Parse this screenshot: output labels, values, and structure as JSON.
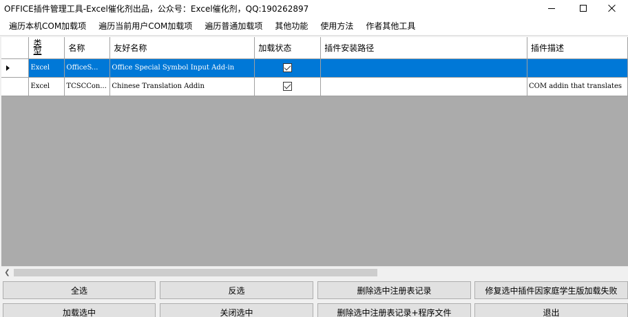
{
  "window": {
    "title": "OFFICE插件管理工具-Excel催化剂出品，公众号：Excel催化剂，QQ:190262897"
  },
  "menu": {
    "items": [
      {
        "label": "遍历本机COM加载项"
      },
      {
        "label": "遍历当前用户COM加载项"
      },
      {
        "label": "遍历普通加载项"
      },
      {
        "label": "其他功能"
      },
      {
        "label": "使用方法"
      },
      {
        "label": "作者其他工具"
      }
    ]
  },
  "grid": {
    "columns": {
      "type_top": "类",
      "type_bottom": "型",
      "name": "名称",
      "friendly_name": "友好名称",
      "load_status": "加载状态",
      "install_path": "插件安装路径",
      "description": "插件描述"
    },
    "rows": [
      {
        "type": "Excel",
        "name": "OfficeS...",
        "friendly_name": "Office Special Symbol Input Add-in",
        "loaded": true,
        "install_path": "",
        "description": "",
        "selected": true
      },
      {
        "type": "Excel",
        "name": "TCSCCon...",
        "friendly_name": "Chinese Translation Addin",
        "loaded": true,
        "install_path": "",
        "description": "COM addin that translates",
        "selected": false
      }
    ]
  },
  "buttons": {
    "select_all": "全选",
    "invert_selection": "反选",
    "delete_registry": "删除选中注册表记录",
    "repair_student": "修复选中插件因家庭学生版加载失败",
    "load_selected": "加载选中",
    "close_selected": "关闭选中",
    "delete_registry_files": "删除选中注册表记录+程序文件",
    "exit": "退出"
  },
  "colors": {
    "selection": "#0078d7",
    "grid_background": "#ababab",
    "window_background": "#f0f0f0"
  }
}
